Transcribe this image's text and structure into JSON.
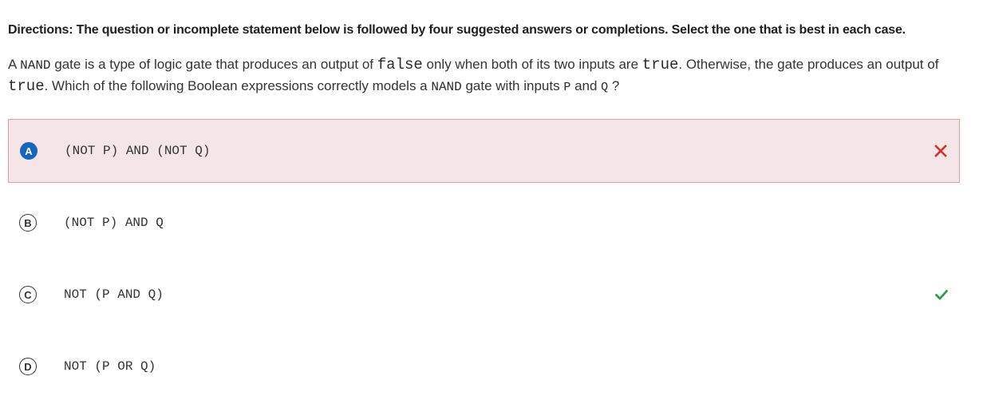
{
  "directions": "Directions: The question or incomplete statement below is followed by four suggested answers or completions. Select the one that is best in each case.",
  "question": {
    "p1": "A ",
    "c1": "NAND",
    "p2": " gate is a type of logic gate that produces an output of ",
    "c2": "false",
    "p3": " only when both of its two inputs are ",
    "c3": "true",
    "p4": ". Otherwise, the gate produces an output of ",
    "c4": "true",
    "p5": ". Which of the following Boolean expressions correctly models a ",
    "c5": "NAND",
    "p6": " gate with inputs ",
    "c6": "P",
    "p7": " and ",
    "c7": "Q",
    "p8": " ?"
  },
  "options": [
    {
      "letter": "A",
      "text": "(NOT P) AND (NOT Q)",
      "status": "incorrect",
      "selected": true
    },
    {
      "letter": "B",
      "text": "(NOT P) AND Q",
      "status": "none",
      "selected": false
    },
    {
      "letter": "C",
      "text": "NOT (P AND Q)",
      "status": "correct",
      "selected": false
    },
    {
      "letter": "D",
      "text": "NOT (P OR Q)",
      "status": "none",
      "selected": false
    }
  ],
  "icons": {
    "incorrect": "x-mark-icon",
    "correct": "check-mark-icon"
  },
  "colors": {
    "selected_badge": "#1565c0",
    "incorrect_bg": "#f4e6e6",
    "incorrect_border": "#e0a1a6",
    "incorrect_mark": "#d32f2f",
    "correct_mark": "#2e9e3e"
  }
}
